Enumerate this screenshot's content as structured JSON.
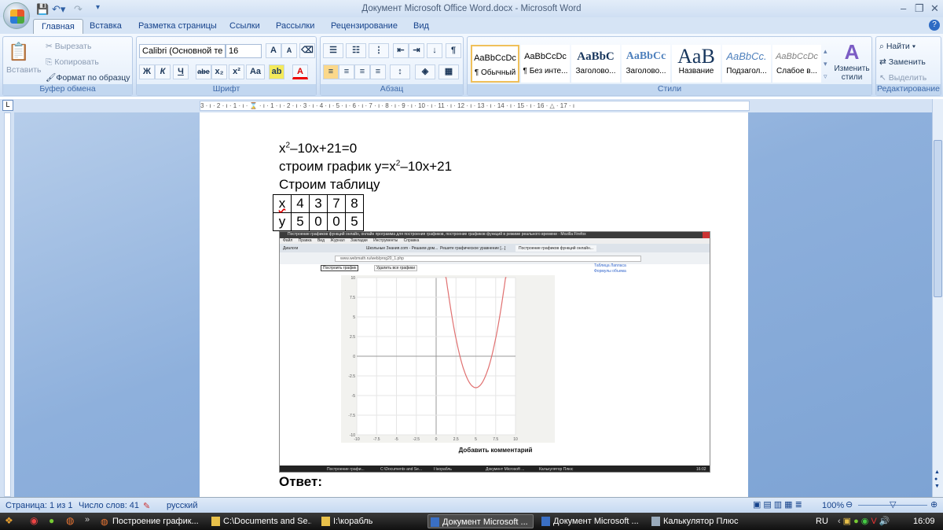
{
  "window": {
    "title": "Документ Microsoft Office Word.docx - Microsoft Word"
  },
  "tabs": [
    "Главная",
    "Вставка",
    "Разметка страницы",
    "Ссылки",
    "Рассылки",
    "Рецензирование",
    "Вид"
  ],
  "clipboard": {
    "paste": "Вставить",
    "cut": "Вырезать",
    "copy": "Копировать",
    "format_painter": "Формат по образцу",
    "label": "Буфер обмена"
  },
  "font": {
    "name": "Calibri (Основной те",
    "size": "16",
    "label": "Шрифт",
    "bold": "Ж",
    "italic": "К",
    "underline": "Ч",
    "strike": "abe",
    "sub": "x₂",
    "sup": "x²",
    "case": "Aa",
    "grow": "A",
    "shrink": "A"
  },
  "paragraph": {
    "label": "Абзац"
  },
  "styles": {
    "label": "Стили",
    "items": [
      {
        "sample": "AaBbCcDc",
        "name": "¶ Обычный"
      },
      {
        "sample": "AaBbCcDc",
        "name": "¶ Без инте..."
      },
      {
        "sample": "AaBbC",
        "name": "Заголово..."
      },
      {
        "sample": "AaBbCc",
        "name": "Заголово..."
      },
      {
        "sample": "AaB",
        "name": "Название"
      },
      {
        "sample": "AaBbCc.",
        "name": "Подзагол..."
      },
      {
        "sample": "AaBbCcDc",
        "name": "Слабое в..."
      }
    ],
    "change": "Изменить стили"
  },
  "editing": {
    "find": "Найти",
    "replace": "Заменить",
    "select": "Выделить",
    "label": "Редактирование"
  },
  "ruler": "3 · ı · 2 · ı · 1 · ı · ⌛ · ı · 1 · ı · 2 · ı · 3 · ı · 4 · ı · 5 · ı · 6 · ı · 7 · ı · 8 · ı · 9 · ı · 10 · ı · 11 · ı · 12 · ı · 13 · ı · 14 · ı · 15 · ı · 16 · △ · 17 · ı",
  "document": {
    "line1": {
      "a": "x",
      "sup": "2",
      "b": "–10x+21=0"
    },
    "line2": {
      "a": "строим график y=x",
      "sup": "2",
      "b": "–10x+21"
    },
    "line3": "Строим таблицу",
    "table": [
      [
        "x",
        "4",
        "3",
        "7",
        "8"
      ],
      [
        "y",
        "5",
        "0",
        "0",
        "5"
      ]
    ],
    "answer": "Ответ:"
  },
  "embedded_screenshot": {
    "title": "Построение графиков функций онлайн, онлайн программа для построения графиков, построение графиков функций в режиме реального времени - Mozilla Firefox",
    "menu": [
      "Файл",
      "Правка",
      "Вид",
      "Журнал",
      "Закладки",
      "Инструменты",
      "Справка"
    ],
    "tabs": [
      "Диалоги",
      "Школьные Знания.com - Решаем дом...",
      "Решите графическое уравнение [...]",
      "Построение графиков функций онлайн..."
    ],
    "url": "www.webmath.ru/web/prog20_1.php",
    "build_btn": "Построить график",
    "delete_btn": "Удалить все графики",
    "links": [
      "Таблица Лапласа",
      "Формулы объема"
    ],
    "comment": "Добавить комментарий",
    "graph": {
      "function": "x^2-10x+21",
      "a": 1,
      "b": -10,
      "c": 21,
      "xlim": [
        -10,
        10
      ],
      "ylim": [
        -10,
        10
      ],
      "xticks": [
        "-10",
        "-7.5",
        "-5",
        "-2.5",
        "0",
        "2.5",
        "5",
        "7.5",
        "10"
      ],
      "yticks": [
        "10",
        "7.5",
        "5",
        "2.5",
        "0",
        "-2.5",
        "-5",
        "-7.5",
        "-10"
      ],
      "color": "#e07070"
    },
    "taskbar": [
      "Построение графи...",
      "C:\\Documents and Se...",
      "I:\\корабль",
      "Документ Microsoft ...",
      "Калькулятор Плюс"
    ],
    "clock": "16:02"
  },
  "status": {
    "page": "Страница: 1 из 1",
    "words": "Число слов: 41",
    "lang": "русский",
    "zoom": "100%"
  },
  "taskbar": {
    "items": [
      "Построение график...",
      "C:\\Documents and Se...",
      "I:\\корабль",
      "Документ Microsoft ...",
      "Документ Microsoft ...",
      "Калькулятор Плюс"
    ],
    "lang": "RU",
    "clock": "16:09"
  }
}
